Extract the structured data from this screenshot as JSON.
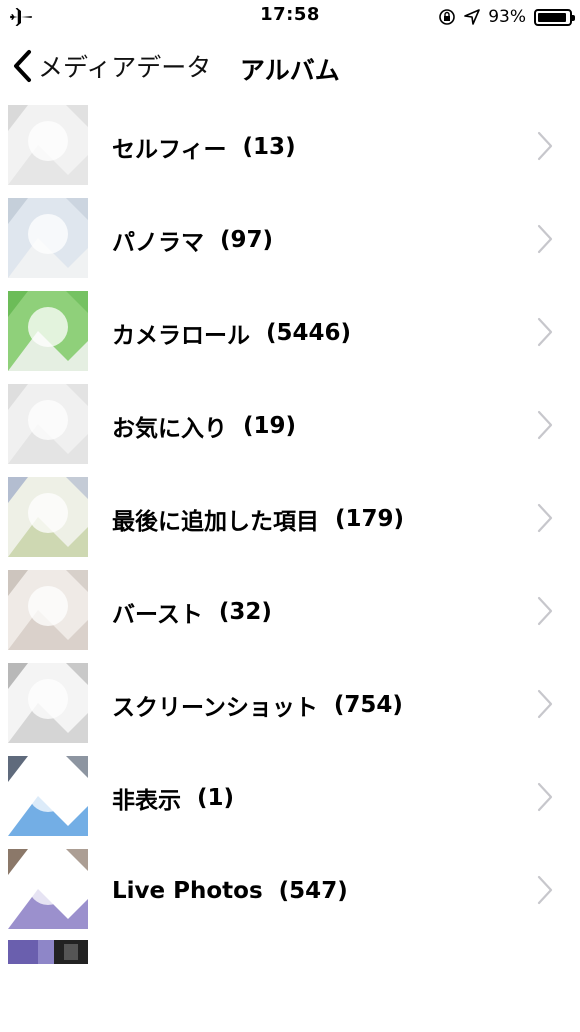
{
  "status_bar": {
    "time": "17:58",
    "battery_percent": "93%",
    "battery_level": 0.93,
    "icons": [
      "airplane-mode-icon",
      "rotation-lock-icon",
      "location-icon",
      "battery-icon"
    ]
  },
  "nav": {
    "back_label": "メディアデータ",
    "title": "アルバム"
  },
  "albums": [
    {
      "name": "セルフィー",
      "count": "(13)",
      "thumb_colors": [
        "#f2f2f2",
        "#e4e4e4",
        "#cfcfcf"
      ]
    },
    {
      "name": "パノラマ",
      "count": "(97)",
      "thumb_colors": [
        "#dfe6ee",
        "#f3f3f3",
        "#b9c4d2"
      ]
    },
    {
      "name": "カメラロール",
      "count": "(5446)",
      "thumb_colors": [
        "#8fd07a",
        "#f4f4f4",
        "#5cb34a"
      ]
    },
    {
      "name": "お気に入り",
      "count": "(19)",
      "thumb_colors": [
        "#f0f0f0",
        "#e2e2e2",
        "#d5d5d5"
      ]
    },
    {
      "name": "最後に追加した項目",
      "count": "(179)",
      "thumb_colors": [
        "#eef0e6",
        "#c8d4a8",
        "#9aa6c6"
      ]
    },
    {
      "name": "バースト",
      "count": "(32)",
      "thumb_colors": [
        "#efeae6",
        "#d6cdc6",
        "#bfb5ad"
      ]
    },
    {
      "name": "スクリーンショット",
      "count": "(754)",
      "thumb_colors": [
        "#f4f4f4",
        "#cfcfcf",
        "#9e9e9e"
      ]
    },
    {
      "name": "非表示",
      "count": "(1)",
      "thumb_colors": [
        "#ffffff",
        "#5aa0e0",
        "#1b2b44"
      ]
    },
    {
      "name": "Live Photos",
      "count": "(547)",
      "thumb_colors": [
        "#ffffff",
        "#8a7cc4",
        "#5a3e2a"
      ]
    }
  ]
}
